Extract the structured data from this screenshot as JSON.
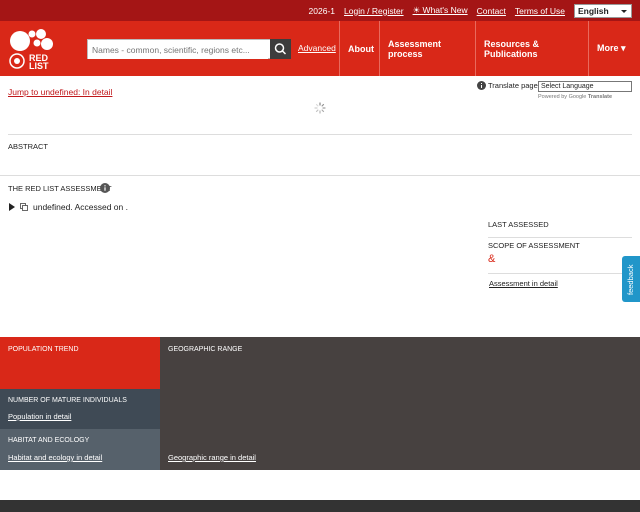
{
  "topbar": {
    "version": "2026-1",
    "login": "Login / Register",
    "whats_new": "☀ What's New",
    "contact": "Contact",
    "terms": "Terms of Use",
    "language": "English"
  },
  "header": {
    "logo_text_1": "RED",
    "logo_text_2": "LIST",
    "search_placeholder": "Names - common, scientific, regions etc...",
    "advanced": "Advanced",
    "nav": [
      "About",
      "Assessment process",
      "Resources & Publications",
      "More ▾"
    ]
  },
  "main": {
    "jump": "Jump to undefined: In detail",
    "translate_label": "Translate page",
    "translate_select": "Select Language",
    "powered_by": "Powered by",
    "google": "Google",
    "translate_word": "Translate",
    "abstract": "ABSTRACT",
    "assessment_heading": "THE RED LIST ASSESSMENT",
    "citation": "undefined. Accessed on .",
    "last_assessed": "LAST ASSESSED",
    "scope": "SCOPE OF ASSESSMENT",
    "scope_value": "&",
    "assessment_link": "Assessment in detail"
  },
  "panels": {
    "population_trend": "POPULATION TREND",
    "geographic_range": "GEOGRAPHIC RANGE",
    "mature_individuals": "NUMBER OF MATURE INDIVIDUALS",
    "population_link": "Population in detail",
    "habitat": "HABITAT AND ECOLOGY",
    "habitat_link": "Habitat and ecology in detail",
    "geo_link": "Geographic range in detail"
  },
  "feedback": "feedback",
  "colors": {
    "topbar": "#a41515",
    "header": "#d92818",
    "population_trend": "#d92818",
    "geo_panel": "#474140",
    "mature_panel": "#3f4a55",
    "habitat_panel": "#56616b",
    "feedback": "#2196c9"
  }
}
